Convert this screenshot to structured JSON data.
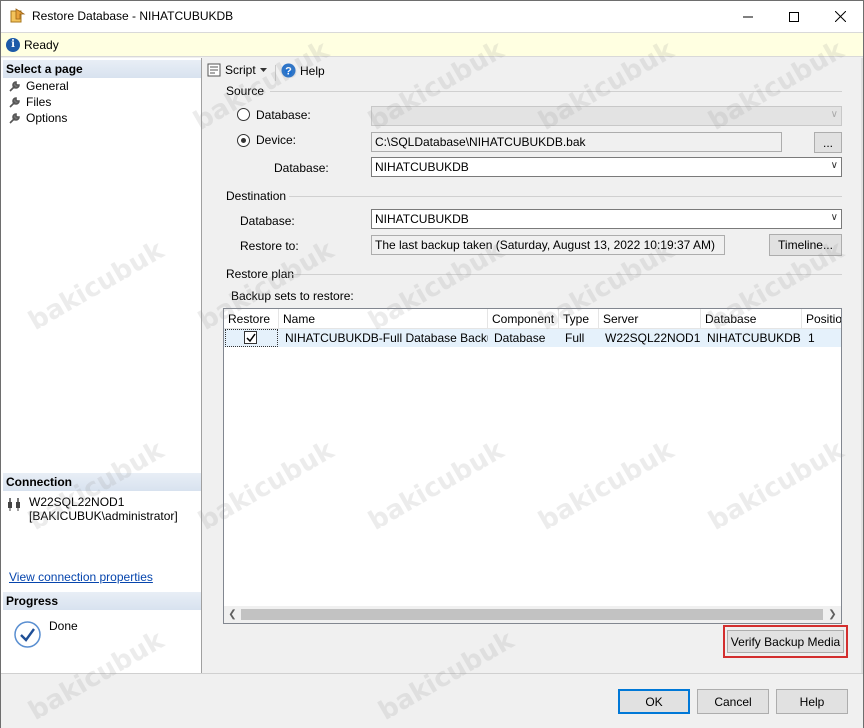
{
  "window": {
    "title": "Restore Database - NIHATCUBUKDB"
  },
  "status": {
    "text": "Ready"
  },
  "left": {
    "select_page_header": "Select a page",
    "pages": [
      "General",
      "Files",
      "Options"
    ],
    "connection_header": "Connection",
    "server": "W22SQL22NOD1",
    "user": "[BAKICUBUK\\administrator]",
    "connection_link": "View connection properties",
    "progress_header": "Progress",
    "progress_status": "Done"
  },
  "toolbar": {
    "script_label": "Script",
    "help_label": "Help"
  },
  "source": {
    "label": "Source",
    "database_radio": "Database:",
    "device_radio": "Device:",
    "device_path": "C:\\SQLDatabase\\NIHATCUBUKDB.bak",
    "browse_label": "...",
    "database_label": "Database:",
    "database_value": "NIHATCUBUKDB"
  },
  "destination": {
    "label": "Destination",
    "database_label": "Database:",
    "database_value": "NIHATCUBUKDB",
    "restore_to_label": "Restore to:",
    "restore_to_value": "The last backup taken (Saturday, August 13, 2022 10:19:37 AM)",
    "timeline_label": "Timeline..."
  },
  "restore_plan": {
    "label": "Restore plan",
    "backup_sets_label": "Backup sets to restore:",
    "columns": [
      "Restore",
      "Name",
      "Component",
      "Type",
      "Server",
      "Database",
      "Position"
    ],
    "rows": [
      {
        "restore": true,
        "name": "NIHATCUBUKDB-Full Database Backup",
        "component": "Database",
        "type": "Full",
        "server": "W22SQL22NOD1",
        "database": "NIHATCUBUKDB",
        "position": "1"
      }
    ]
  },
  "verify_label": "Verify Backup Media",
  "buttons": {
    "ok": "OK",
    "cancel": "Cancel",
    "help": "Help"
  },
  "watermark_text": "bakicubuk",
  "colors": {
    "highlight": "#d32f2f",
    "status_bg": "#ffffe1",
    "link": "#0645ad"
  }
}
